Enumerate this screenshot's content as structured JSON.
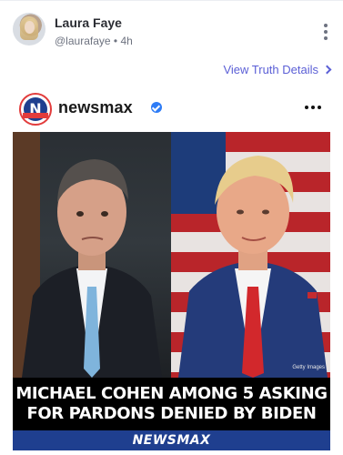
{
  "post": {
    "author_name": "Laura Faye",
    "author_handle": "@laurafaye",
    "time": "4h",
    "view_details_label": "View Truth Details"
  },
  "card": {
    "publisher_name": "newsmax",
    "logo_letter": "N",
    "media": {
      "photo_credit": "Getty Images",
      "headline_line1": "MICHAEL COHEN AMONG 5 ASKING",
      "headline_line2": "FOR PARDONS DENIED BY BIDEN",
      "brand_label": "NEWSMAX"
    }
  },
  "icons": {
    "more_post": "vertical-ellipsis-icon",
    "more_card": "horizontal-ellipsis-icon",
    "chevron": "chevron-right-icon",
    "verified": "verified-badge-icon"
  },
  "colors": {
    "accent": "#5b5fd6",
    "newsmax_blue": "#1f3f8f",
    "newsmax_red": "#e23c3c",
    "verified_blue": "#2e7cf6"
  }
}
